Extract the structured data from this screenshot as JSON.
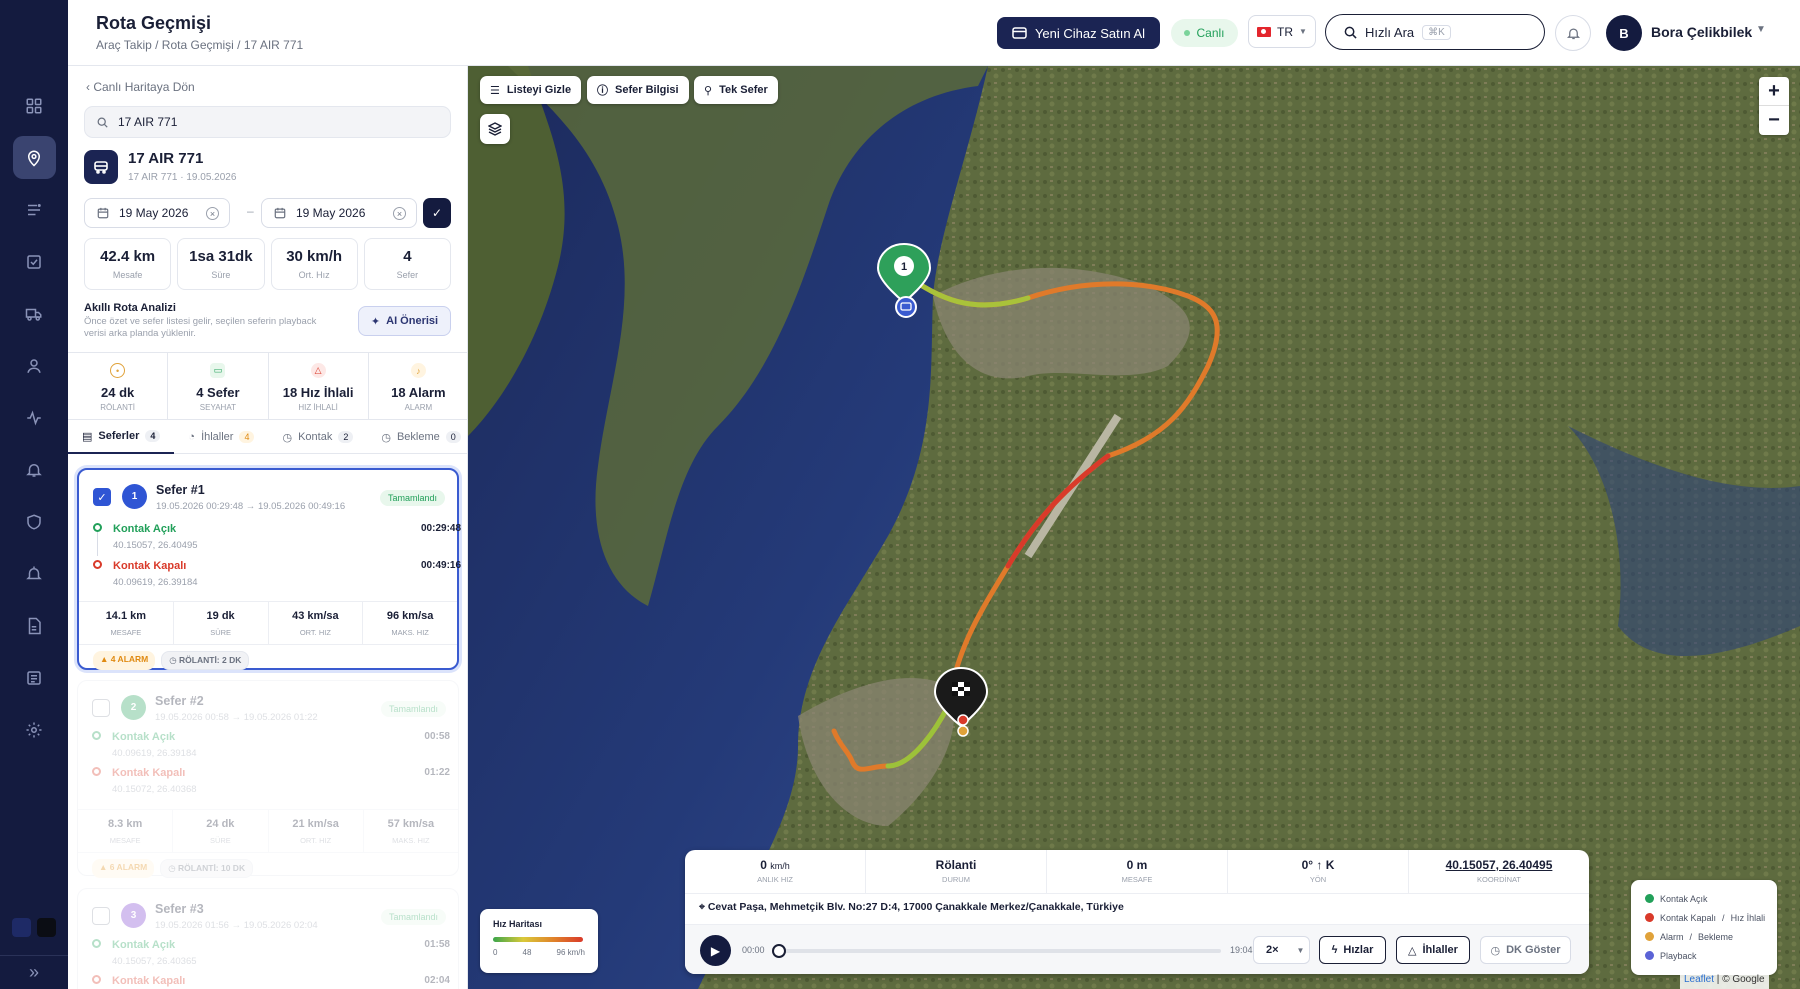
{
  "header": {
    "title": "Rota Geçmişi",
    "breadcrumb": "Araç Takip / Rota Geçmişi / 17 AIR 771",
    "buy_button": "Yeni Cihaz Satın Al",
    "live_label": "Canlı",
    "language": "TR",
    "search_placeholder": "Hızlı Ara",
    "search_shortcut": "⌘K",
    "user_initial": "B",
    "user_name": "Bora Çelikbilek"
  },
  "sidebar": {
    "items": [
      "dashboard-icon",
      "location-pin-icon",
      "list-icon",
      "checklist-icon",
      "truck-icon",
      "user-icon",
      "activity-icon",
      "bell-icon",
      "shield-icon",
      "alarm-icon",
      "document-icon",
      "report-icon",
      "settings-icon"
    ],
    "active_index": 1
  },
  "panel": {
    "back_label": "Canlı Haritaya Dön",
    "search_value": "17 AIR 771",
    "vehicle": {
      "plate": "17 AIR 771",
      "subtitle": "17 AIR 771 · 19.05.2026"
    },
    "date_from": "19 May 2026",
    "date_to": "19 May 2026",
    "summary": [
      {
        "value": "42.4 km",
        "label": "Mesafe"
      },
      {
        "value": "1sa 31dk",
        "label": "Süre"
      },
      {
        "value": "30 km/h",
        "label": "Ort. Hız"
      },
      {
        "value": "4",
        "label": "Sefer"
      }
    ],
    "ai": {
      "title": "Akıllı Rota Analizi",
      "desc": "Önce özet ve sefer listesi gelir, seçilen seferin playback verisi arka planda yüklenir.",
      "button": "AI Önerisi"
    },
    "kpis": [
      {
        "value": "24 dk",
        "label": "RÖLANTİ",
        "color": "#e0a23a"
      },
      {
        "value": "4 Sefer",
        "label": "SEYAHAT",
        "color": "#22a05a"
      },
      {
        "value": "18 Hız İhlali",
        "label": "HIZ İHLALİ",
        "color": "#d93a2a"
      },
      {
        "value": "18 Alarm",
        "label": "ALARM",
        "color": "#e0a23a"
      }
    ],
    "tabs": [
      {
        "label": "Seferler",
        "count": "4"
      },
      {
        "label": "İhlaller",
        "count": "4"
      },
      {
        "label": "Kontak",
        "count": "2"
      },
      {
        "label": "Bekleme",
        "count": "0"
      }
    ],
    "trips": [
      {
        "number": "1",
        "title": "Sefer #1",
        "range": "19.05.2026 00:29:48 → 19.05.2026 00:49:16",
        "status": "Tamamlandı",
        "start_label": "Kontak Açık",
        "start_coord": "40.15057, 26.40495",
        "start_time": "00:29:48",
        "end_label": "Kontak Kapalı",
        "end_coord": "40.09619, 26.39184",
        "end_time": "00:49:16",
        "stats": [
          {
            "v": "14.1 km",
            "l": "MESAFE"
          },
          {
            "v": "19 dk",
            "l": "SÜRE"
          },
          {
            "v": "43 km/sa",
            "l": "ORT. HIZ"
          },
          {
            "v": "96 km/sa",
            "l": "MAKS. HIZ"
          }
        ],
        "alarm_tag": "4 ALARM",
        "idle_tag": "RÖLANTİ: 2 DK",
        "color": "#2f55d4"
      },
      {
        "number": "2",
        "title": "Sefer #2",
        "range": "19.05.2026 00:58 → 19.05.2026 01:22",
        "status": "Tamamlandı",
        "start_label": "Kontak Açık",
        "start_coord": "40.09619, 26.39184",
        "start_time": "00:58",
        "end_label": "Kontak Kapalı",
        "end_coord": "40.15072, 26.40368",
        "end_time": "01:22",
        "stats": [
          {
            "v": "8.3 km",
            "l": "MESAFE"
          },
          {
            "v": "24 dk",
            "l": "SÜRE"
          },
          {
            "v": "21 km/sa",
            "l": "ORT. HIZ"
          },
          {
            "v": "57 km/sa",
            "l": "MAKS. HIZ"
          }
        ],
        "alarm_tag": "6 ALARM",
        "idle_tag": "RÖLANTİ: 10 DK",
        "color": "#22a05a"
      },
      {
        "number": "3",
        "title": "Sefer #3",
        "range": "19.05.2026 01:56 → 19.05.2026 02:04",
        "status": "Tamamlandı",
        "start_label": "Kontak Açık",
        "start_coord": "40.15057, 26.40365",
        "start_time": "01:58",
        "end_label": "Kontak Kapalı",
        "end_time": "02:04",
        "color": "#7a3ad0"
      }
    ]
  },
  "map": {
    "buttons": {
      "hide_list": "Listeyi Gizle",
      "trip_info": "Sefer Bilgisi",
      "single_trip": "Tek Sefer"
    },
    "start_marker": "1",
    "speed_legend": {
      "title": "Hız Haritası",
      "ticks": [
        "0",
        "48",
        "96 km/h"
      ]
    },
    "playback": {
      "stats": [
        {
          "value": "0",
          "unit": "km/h",
          "label": "ANLIK HIZ"
        },
        {
          "value": "Rölanti",
          "label": "DURUM"
        },
        {
          "value": "0 m",
          "label": "MESAFE"
        },
        {
          "value": "0° ↑ K",
          "label": "YÖN"
        },
        {
          "value": "40.15057, 26.40495",
          "label": "KOORDİNAT"
        }
      ],
      "address": "Cevat Paşa, Mehmetçik Blv. No:27 D:4, 17000 Çanakkale Merkez/Çanakkale, Türkiye",
      "time_start": "00:00",
      "time_end": "19:04",
      "speed": "2×",
      "btn_speeds": "Hızlar",
      "btn_violations": "İhlaller",
      "btn_dk": "DK Göster"
    },
    "legend": [
      {
        "label": "Kontak Açık",
        "color": "#22a05a"
      },
      {
        "label": "Kontak Kapalı",
        "extra": "Hız İhlali",
        "color": "#d93a2a"
      },
      {
        "label": "Alarm",
        "extra": "Bekleme",
        "color": "#e0a23a"
      },
      {
        "label": "Playback",
        "color": "#5b63d6"
      }
    ],
    "attribution": {
      "leaflet": "Leaflet",
      "google": "© Google"
    }
  }
}
